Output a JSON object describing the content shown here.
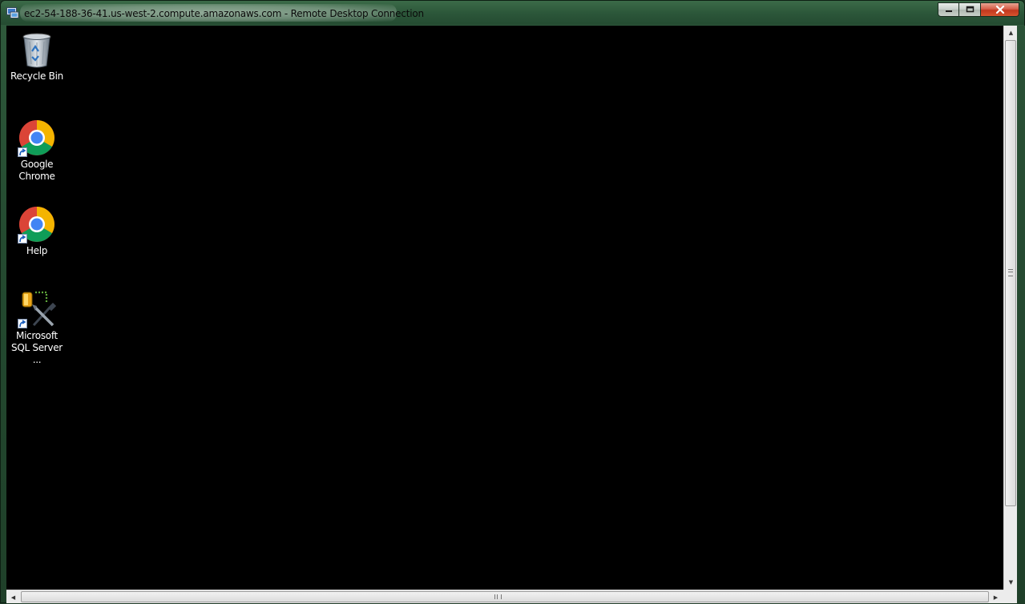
{
  "window": {
    "title": "ec2-54-188-36-41.us-west-2.compute.amazonaws.com - Remote Desktop Connection"
  },
  "desktop": {
    "icons": [
      {
        "label_lines": [
          "Recycle Bin"
        ],
        "icon": "recycle-bin-icon"
      },
      {
        "label_lines": [
          "Google",
          "Chrome"
        ],
        "icon": "chrome-icon"
      },
      {
        "label_lines": [
          "Help"
        ],
        "icon": "chrome-icon"
      },
      {
        "label_lines": [
          "Microsoft",
          "SQL Server ..."
        ],
        "icon": "sql-server-management-icon"
      }
    ]
  },
  "colors": {
    "desktop_background": "#000000",
    "titlebar": "#2c573a",
    "close_button": "#c2381f"
  }
}
